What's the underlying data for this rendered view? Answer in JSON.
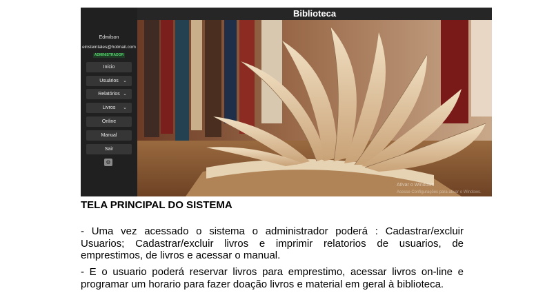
{
  "app": {
    "title": "Biblioteca",
    "user": {
      "name": "Edmilson",
      "email": "einsteintales@hotmail.com",
      "role": "ADMINISTRADOR"
    },
    "menu": [
      {
        "label": "Início",
        "has_dropdown": false
      },
      {
        "label": "Usuários",
        "has_dropdown": true
      },
      {
        "label": "Relatórios",
        "has_dropdown": true
      },
      {
        "label": "Livros",
        "has_dropdown": true
      },
      {
        "label": "Online",
        "has_dropdown": false
      },
      {
        "label": "Manual",
        "has_dropdown": false
      },
      {
        "label": "Sair",
        "has_dropdown": false
      }
    ],
    "chevron": "⌄",
    "settings_icon": "gear-icon",
    "watermark": {
      "line1": "Ativar o Windows",
      "line2": "Acesse Configurações para ativar o Windows."
    },
    "colors": {
      "sidebar": "#202020",
      "badge_text": "#55d36d"
    }
  },
  "document": {
    "heading": "TELA PRINCIPAL DO SISTEMA",
    "paragraph1": "- Uma vez acessado o sistema o administrador poderá : Cadastrar/excluir Usuarios; Cadastrar/excluir livros e imprimir relatorios de usuarios, de emprestimos, de livros e acessar o manual.",
    "paragraph2": "- E o usuario poderá reservar livros para emprestimo, acessar livros on-line e programar um horario para fazer doação livros e material em geral à biblioteca."
  }
}
